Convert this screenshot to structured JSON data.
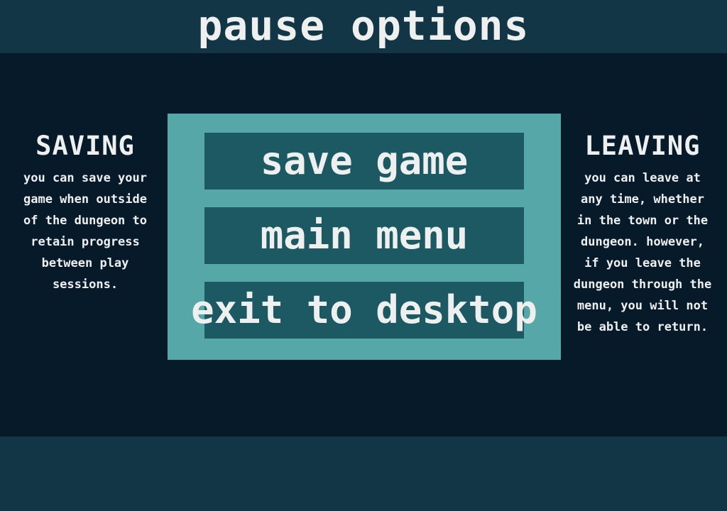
{
  "header": {
    "title": "pause options"
  },
  "left_panel": {
    "heading": "SAVING",
    "lines": [
      "you can save your",
      "game when outside",
      "of the dungeon to",
      "retain progress",
      "between play",
      "sessions."
    ]
  },
  "right_panel": {
    "heading": "LEAVING",
    "lines": [
      "you can leave at",
      "any time, whether",
      "in the town or the",
      "dungeon. however,",
      "if you leave the",
      "dungeon through the",
      "menu, you will not",
      "be able to return."
    ]
  },
  "menu": {
    "buttons": [
      {
        "label": "save game"
      },
      {
        "label": "main menu"
      },
      {
        "label": "exit to desktop"
      }
    ]
  },
  "colors": {
    "background": "#071a2a",
    "bars": "#133646",
    "menu_panel": "#56a7a7",
    "button": "#1d5962",
    "text": "#eef0f0"
  }
}
